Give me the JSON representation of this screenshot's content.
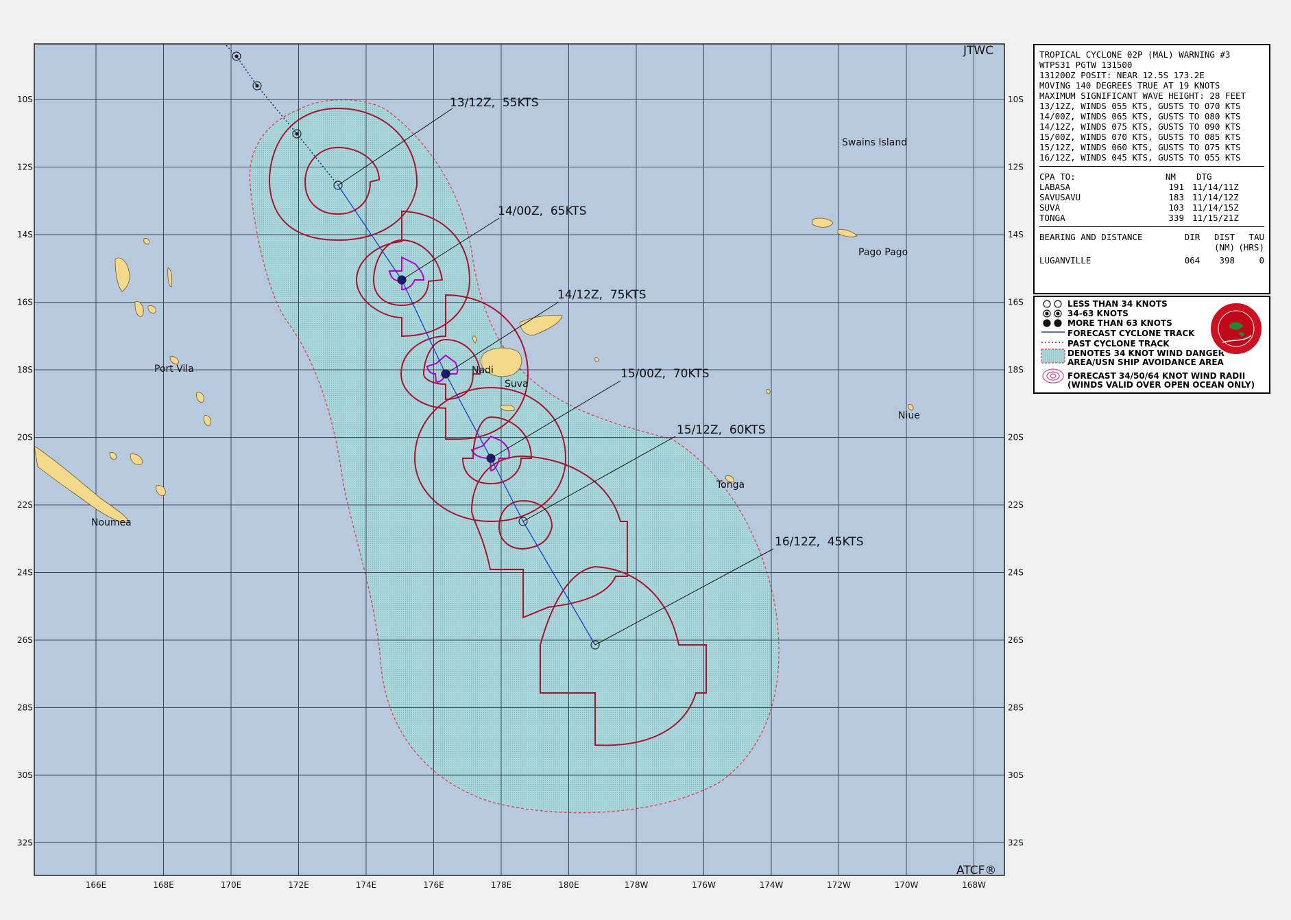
{
  "header": {
    "agency": "JTWC",
    "software": "ATCF®"
  },
  "map": {
    "lat_labels": [
      "10S",
      "12S",
      "14S",
      "16S",
      "18S",
      "20S",
      "22S",
      "24S",
      "26S",
      "28S",
      "30S",
      "32S"
    ],
    "lon_labels": [
      "166E",
      "168E",
      "170E",
      "172E",
      "174E",
      "176E",
      "178E",
      "180E",
      "178W",
      "176W",
      "174W",
      "172W",
      "170W",
      "168W"
    ],
    "places": [
      {
        "name": "Swains Island"
      },
      {
        "name": "Pago Pago"
      },
      {
        "name": "Port Vila"
      },
      {
        "name": "Nadi"
      },
      {
        "name": "Suva"
      },
      {
        "name": "Niue"
      },
      {
        "name": "Tonga"
      },
      {
        "name": "Noumea"
      }
    ],
    "forecast_points": [
      {
        "label": "13/12Z,  55KTS"
      },
      {
        "label": "14/00Z,  65KTS"
      },
      {
        "label": "14/12Z,  75KTS"
      },
      {
        "label": "15/00Z,  70KTS"
      },
      {
        "label": "15/12Z,  60KTS"
      },
      {
        "label": "16/12Z,  45KTS"
      }
    ],
    "colors": {
      "ocean": "#b7c9dc",
      "land": "#f5d98a",
      "danger_area": "#a9d6d8",
      "wind_radii_34_50": "#b01030",
      "wind_radii_64": "#b000e0",
      "track": "#1a3ccc"
    }
  },
  "warning": {
    "lines": [
      "TROPICAL CYCLONE 02P (MAL) WARNING #3",
      "WTPS31 PGTW 131500",
      "131200Z POSIT: NEAR 12.5S 173.2E",
      "MOVING 140 DEGREES TRUE AT 19 KNOTS",
      "MAXIMUM SIGNIFICANT WAVE HEIGHT: 28 FEET",
      "13/12Z, WINDS 055 KTS, GUSTS TO 070 KTS",
      "14/00Z, WINDS 065 KTS, GUSTS TO 080 KTS",
      "14/12Z, WINDS 075 KTS, GUSTS TO 090 KTS",
      "15/00Z, WINDS 070 KTS, GUSTS TO 085 KTS",
      "15/12Z, WINDS 060 KTS, GUSTS TO 075 KTS",
      "16/12Z, WINDS 045 KTS, GUSTS TO 055 KTS"
    ],
    "cpa_header": {
      "to": "CPA TO:",
      "nm": "NM",
      "dtg": "DTG"
    },
    "cpa_rows": [
      {
        "place": "LABASA",
        "nm": "191",
        "dtg": "11/14/11Z"
      },
      {
        "place": "SAVUSAVU",
        "nm": "183",
        "dtg": "11/14/12Z"
      },
      {
        "place": "SUVA",
        "nm": "103",
        "dtg": "11/14/15Z"
      },
      {
        "place": "TONGA",
        "nm": "339",
        "dtg": "11/15/21Z"
      }
    ],
    "bearing_header": {
      "title": "BEARING AND DISTANCE",
      "dir": "DIR",
      "dist": "DIST",
      "tau": "TAU",
      "dist_unit": "(NM)",
      "tau_unit": "(HRS)"
    },
    "bearing_rows": [
      {
        "place": "LUGANVILLE",
        "dir": "064",
        "dist": "398",
        "tau": "0"
      }
    ]
  },
  "legend": {
    "items": [
      "LESS THAN 34 KNOTS",
      "34-63 KNOTS",
      "MORE THAN 63 KNOTS",
      "FORECAST CYCLONE TRACK",
      "PAST CYCLONE TRACK",
      "DENOTES 34 KNOT WIND DANGER\nAREA/USN SHIP AVOIDANCE AREA",
      "FORECAST 34/50/64 KNOT WIND RADII\n(WINDS VALID OVER OPEN OCEAN ONLY)"
    ]
  }
}
